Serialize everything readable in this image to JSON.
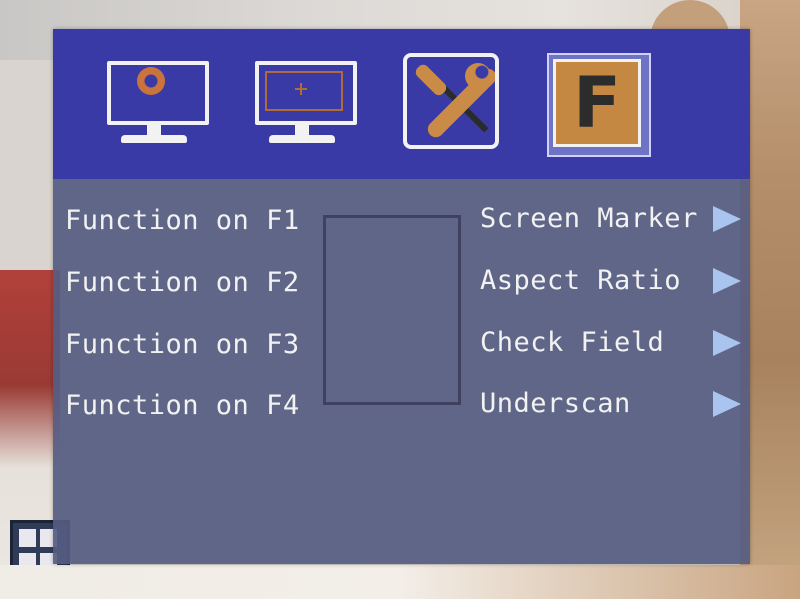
{
  "menu": {
    "tabs": [
      {
        "name": "picture-settings",
        "icon": "monitor-gear-icon",
        "active": false
      },
      {
        "name": "display-settings",
        "icon": "monitor-crosshair-icon",
        "active": false
      },
      {
        "name": "tools",
        "icon": "wrench-screwdriver-icon",
        "active": false
      },
      {
        "name": "function-keys",
        "icon": "f-key-icon",
        "label": "F",
        "active": true
      }
    ],
    "rows": [
      {
        "label": "Function on F1",
        "value": "Screen Marker"
      },
      {
        "label": "Function on F2",
        "value": "Aspect Ratio"
      },
      {
        "label": "Function on F3",
        "value": "Check Field"
      },
      {
        "label": "Function on F4",
        "value": "Underscan"
      }
    ]
  },
  "colors": {
    "header": "#3a3aa6",
    "panel": "#565c82",
    "accent": "#c58843",
    "arrow": "#a9c4ef",
    "text": "#f2f2f2"
  }
}
